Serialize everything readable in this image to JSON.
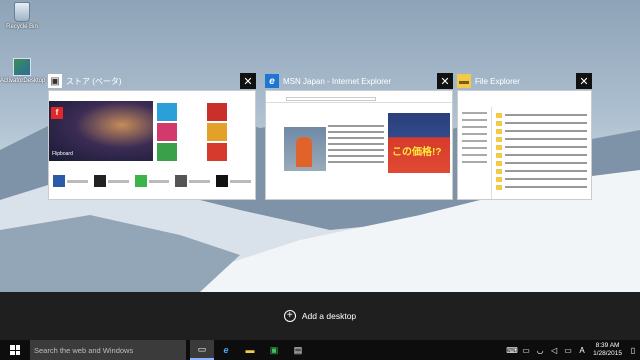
{
  "desktop": {
    "icons": [
      {
        "label": "Recycle Bin"
      },
      {
        "label": "ActivatorDesktop"
      }
    ]
  },
  "task_view": {
    "windows": [
      {
        "title": "ストア (ベータ)",
        "icon": "store-icon",
        "close": "✕",
        "hero_text": "Flipboard"
      },
      {
        "title": "MSN Japan - Internet Explorer",
        "icon": "ie-icon",
        "close": "✕",
        "ad_text": "この価格!?"
      },
      {
        "title": "File Explorer",
        "icon": "folder-icon",
        "close": "✕"
      }
    ]
  },
  "desktops_bar": {
    "add_label": "Add a desktop",
    "add_icon": "+"
  },
  "taskbar": {
    "search_placeholder": "Search the web and Windows",
    "apps": [
      {
        "name": "task-view",
        "glyph": "▭"
      },
      {
        "name": "internet-explorer",
        "glyph": "e"
      },
      {
        "name": "file-explorer",
        "glyph": "▬"
      },
      {
        "name": "store",
        "glyph": "▣"
      },
      {
        "name": "store-2",
        "glyph": "▤"
      }
    ],
    "tray": {
      "keyboard": "⌨",
      "battery": "▭",
      "network": "◡",
      "volume": "◁",
      "notifications": "▭",
      "ime": "A",
      "time": "8:39 AM",
      "date": "1/28/2015"
    }
  },
  "colors": {
    "taskbar": "#0d0d0d",
    "desktops_bar": "#1f1f1f",
    "ie_blue": "#1c76d2",
    "folder_yellow": "#f3c94a"
  }
}
